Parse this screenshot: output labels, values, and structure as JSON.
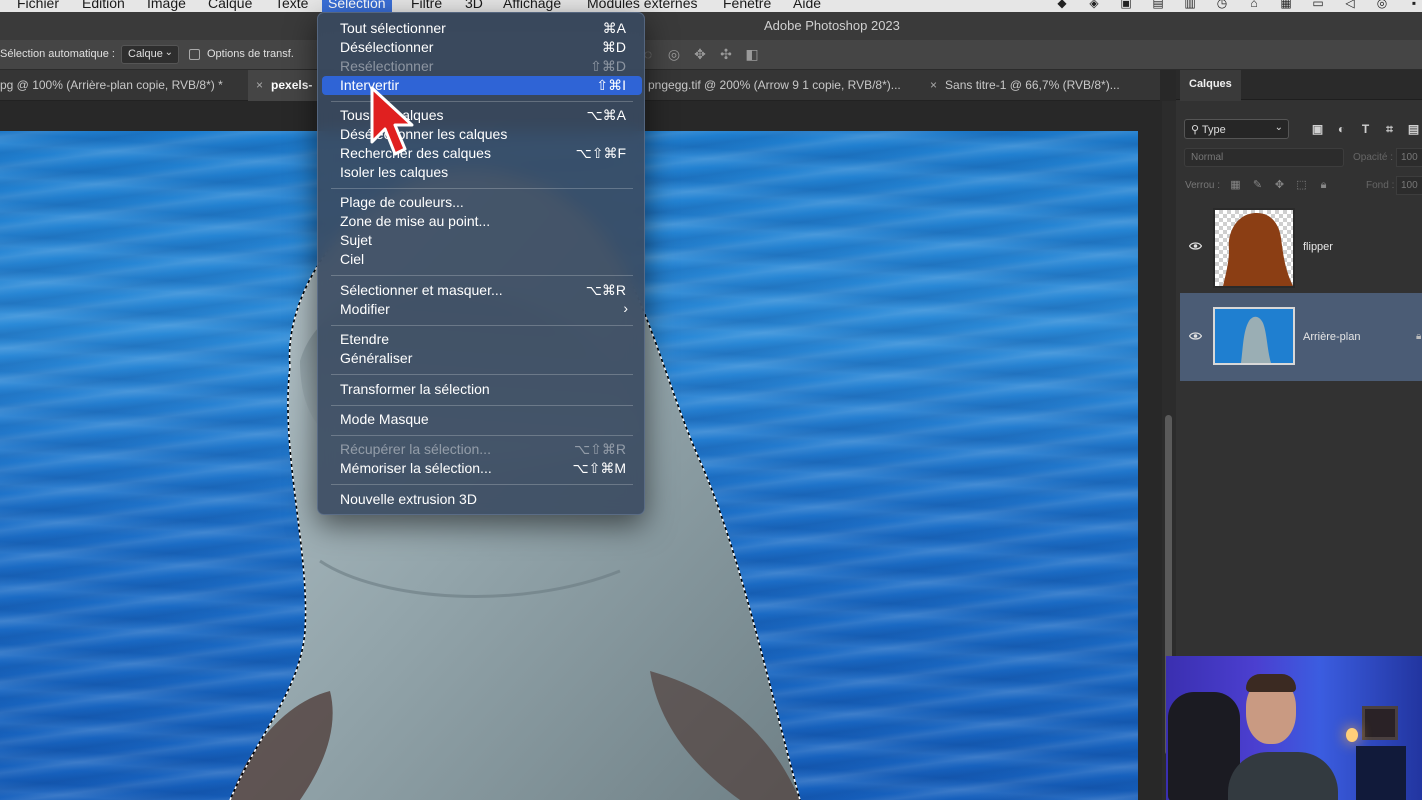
{
  "menubar": {
    "items": [
      "Fichier",
      "Edition",
      "Image",
      "Calque",
      "Texte",
      "Sélection",
      "Filtre",
      "3D",
      "Affichage",
      "Modules externes",
      "Fenêtre",
      "Aide"
    ],
    "active": "Sélection"
  },
  "window": {
    "title": "Adobe Photoshop 2023"
  },
  "options_bar": {
    "auto_select_label": "Sélection automatique :",
    "auto_select_value": "Calque",
    "transform_options_label": "Options de transf."
  },
  "tabs": [
    {
      "label": "pg @ 100% (Arrière-plan copie, RVB/8*) *"
    },
    {
      "label": "pexels-"
    },
    {
      "label": "pngegg.tif @ 200% (Arrow 9 1 copie, RVB/8*)..."
    },
    {
      "label": "Sans titre-1 @ 66,7% (RVB/8*)..."
    }
  ],
  "selection_menu": {
    "groups": [
      [
        {
          "label": "Tout sélectionner",
          "shortcut": "⌘A"
        },
        {
          "label": "Désélectionner",
          "shortcut": "⌘D"
        },
        {
          "label": "Resélectionner",
          "shortcut": "⇧⌘D",
          "disabled": true
        },
        {
          "label": "Intervertir",
          "shortcut": "⇧⌘I",
          "highlighted": true
        }
      ],
      [
        {
          "label": "Tous les calques",
          "shortcut": "⌥⌘A"
        },
        {
          "label": "Désélectionner les calques",
          "shortcut": ""
        },
        {
          "label": "Rechercher des calques",
          "shortcut": "⌥⇧⌘F"
        },
        {
          "label": "Isoler les calques",
          "shortcut": ""
        }
      ],
      [
        {
          "label": "Plage de couleurs...",
          "shortcut": ""
        },
        {
          "label": "Zone de mise au point...",
          "shortcut": ""
        },
        {
          "label": "Sujet",
          "shortcut": ""
        },
        {
          "label": "Ciel",
          "shortcut": ""
        }
      ],
      [
        {
          "label": "Sélectionner et masquer...",
          "shortcut": "⌥⌘R"
        },
        {
          "label": "Modifier",
          "shortcut": "",
          "submenu": true
        }
      ],
      [
        {
          "label": "Etendre",
          "shortcut": ""
        },
        {
          "label": "Généraliser",
          "shortcut": ""
        }
      ],
      [
        {
          "label": "Transformer la sélection",
          "shortcut": ""
        }
      ],
      [
        {
          "label": "Mode Masque",
          "shortcut": ""
        }
      ],
      [
        {
          "label": "Récupérer la sélection...",
          "shortcut": "⌥⇧⌘R",
          "disabled": true
        },
        {
          "label": "Mémoriser la sélection...",
          "shortcut": "⌥⇧⌘M"
        }
      ],
      [
        {
          "label": "Nouvelle extrusion 3D",
          "shortcut": ""
        }
      ]
    ]
  },
  "layers_panel": {
    "tab": "Calques",
    "filter": "Type",
    "blend_mode": "Normal",
    "opacity_label": "Opacité :",
    "opacity_value": "100",
    "lock_label": "Verrou :",
    "fill_label": "Fond :",
    "fill_value": "100",
    "layers": [
      {
        "name": "flipper",
        "selected": false
      },
      {
        "name": "Arrière-plan",
        "selected": true,
        "locked": true
      }
    ]
  },
  "colors": {
    "highlight": "#2f64d6",
    "layer_selected": "#4b5c75",
    "water": "#1f7fd0"
  }
}
